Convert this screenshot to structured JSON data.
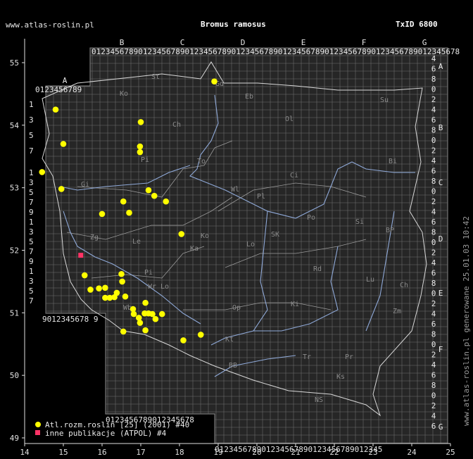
{
  "header": {
    "site": "www.atlas-roslin.pl",
    "species": "Bromus ramosus",
    "taxon": "TxID 6800"
  },
  "side_note": "www.atlas-roslin.pl generowane 25.01.03 10:42",
  "axes": {
    "x_ticks": [
      "14",
      "15",
      "16",
      "17",
      "18",
      "19",
      "20",
      "21",
      "22",
      "23",
      "24",
      "25"
    ],
    "y_ticks": [
      "55",
      "54",
      "53",
      "52",
      "51",
      "50",
      "49"
    ]
  },
  "grid": {
    "top_letters": [
      "B",
      "C",
      "D",
      "E",
      "F",
      "G"
    ],
    "top_digits": "0123456789012345678901234567890123456789012345678901234567890123456789012345678",
    "a_letter": "A",
    "a_digits": "0123456789",
    "bottom_left_digits": "9012345678 9",
    "left_digits_a": [
      "1",
      "3",
      "5",
      "7"
    ],
    "left_digits_b": [
      "1",
      "3",
      "5",
      "7",
      "9",
      "1",
      "3",
      "5",
      "7",
      "9",
      "1",
      "3",
      "5",
      "7"
    ],
    "bottom_mid_digits": "0123456789012345678",
    "bottom_right_digits": "012345678901234567890123456789012345",
    "right_letters": [
      "A",
      "B",
      "C",
      "D",
      "E",
      "F",
      "G"
    ],
    "right_digits": [
      "4",
      "6",
      "8",
      "0",
      "2",
      "4",
      "6",
      "8",
      "0",
      "2",
      "4",
      "6",
      "8",
      "0",
      "2",
      "4",
      "6",
      "8",
      "0",
      "2",
      "4",
      "6",
      "8",
      "0",
      "2",
      "4",
      "6",
      "8",
      "0",
      "2",
      "4",
      "6",
      "8",
      "0",
      "2",
      "4",
      "6",
      "8"
    ]
  },
  "regions": [
    "St",
    "Ko",
    "Gd",
    "Eb",
    "Ol",
    "Su",
    "Ch",
    "Pi",
    "To",
    "Bi",
    "Gi",
    "Ci",
    "Wl",
    "Pl",
    "Ko",
    "Si",
    "Po",
    "SK",
    "BP",
    "Zg",
    "Le",
    "Ka",
    "Lo",
    "Lu",
    "Pi",
    "Rd",
    "Lo",
    "Ch",
    "Wr",
    "Wb",
    "Op",
    "Ki",
    "Zm",
    "Kt",
    "Tr",
    "Pr",
    "BB",
    "NS",
    "Ks"
  ],
  "legend": {
    "entries": [
      {
        "label": "Atl.rozm.roslin [25] (2001) #40",
        "color": "#ffff00",
        "shape": "circle"
      },
      {
        "label": "inne publikacje (ATPOL) #4",
        "color": "#ff3366",
        "shape": "square"
      }
    ]
  },
  "map_data": {
    "x_unit": "degrees longitude E",
    "y_unit": "degrees latitude N",
    "xlim": [
      14,
      25
    ],
    "ylim": [
      49,
      55
    ],
    "atlas_records": [
      {
        "lon": 14.8,
        "lat": 54.25
      },
      {
        "lon": 15.0,
        "lat": 53.7
      },
      {
        "lon": 14.45,
        "lat": 53.25
      },
      {
        "lon": 14.95,
        "lat": 52.98
      },
      {
        "lon": 16.0,
        "lat": 52.58
      },
      {
        "lon": 16.55,
        "lat": 52.78
      },
      {
        "lon": 16.7,
        "lat": 52.6
      },
      {
        "lon": 17.0,
        "lat": 54.05
      },
      {
        "lon": 16.98,
        "lat": 53.66
      },
      {
        "lon": 16.98,
        "lat": 53.57
      },
      {
        "lon": 17.2,
        "lat": 52.96
      },
      {
        "lon": 17.35,
        "lat": 52.87
      },
      {
        "lon": 17.65,
        "lat": 52.78
      },
      {
        "lon": 18.05,
        "lat": 52.26
      },
      {
        "lon": 18.9,
        "lat": 54.7
      },
      {
        "lon": 15.55,
        "lat": 51.6
      },
      {
        "lon": 15.7,
        "lat": 51.37
      },
      {
        "lon": 15.92,
        "lat": 51.39
      },
      {
        "lon": 16.08,
        "lat": 51.4
      },
      {
        "lon": 16.5,
        "lat": 51.62
      },
      {
        "lon": 16.52,
        "lat": 51.5
      },
      {
        "lon": 16.6,
        "lat": 51.26
      },
      {
        "lon": 16.08,
        "lat": 51.24
      },
      {
        "lon": 16.2,
        "lat": 51.24
      },
      {
        "lon": 16.32,
        "lat": 51.25
      },
      {
        "lon": 16.38,
        "lat": 51.32
      },
      {
        "lon": 16.8,
        "lat": 51.06
      },
      {
        "lon": 16.82,
        "lat": 50.98
      },
      {
        "lon": 16.95,
        "lat": 50.92
      },
      {
        "lon": 16.98,
        "lat": 50.84
      },
      {
        "lon": 17.1,
        "lat": 50.99
      },
      {
        "lon": 17.2,
        "lat": 50.99
      },
      {
        "lon": 17.3,
        "lat": 50.98
      },
      {
        "lon": 17.38,
        "lat": 50.9
      },
      {
        "lon": 17.55,
        "lat": 50.98
      },
      {
        "lon": 17.12,
        "lat": 51.16
      },
      {
        "lon": 16.55,
        "lat": 50.7
      },
      {
        "lon": 17.12,
        "lat": 50.72
      },
      {
        "lon": 18.1,
        "lat": 50.56
      },
      {
        "lon": 18.55,
        "lat": 50.65
      }
    ],
    "other_records": [
      {
        "lon": 15.45,
        "lat": 51.92
      }
    ]
  }
}
